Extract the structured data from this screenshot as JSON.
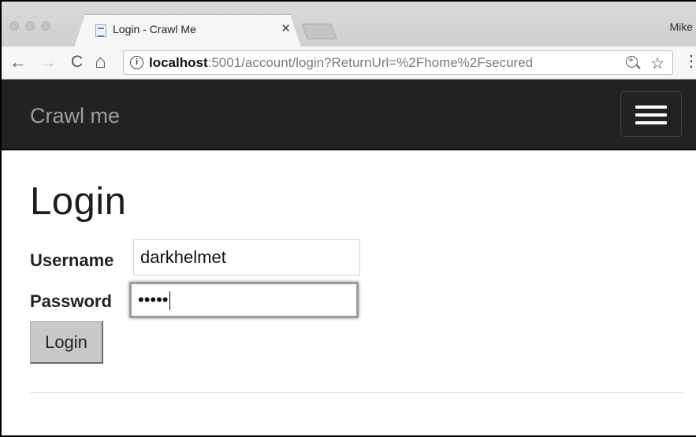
{
  "browser": {
    "tab_title": "Login - Crawl Me",
    "tab_close": "×",
    "profile_name": "Mike",
    "url_host": "localhost",
    "url_rest": ":5001/account/login?ReturnUrl=%2Fhome%2Fsecured",
    "icons": {
      "back": "←",
      "forward": "→",
      "reload": "C",
      "home": "⌂",
      "info": "i",
      "star": "☆",
      "menu": "⋮"
    }
  },
  "navbar": {
    "brand": "Crawl me",
    "toggle_icon": "hamburger-icon"
  },
  "page": {
    "title": "Login",
    "username_label": "Username",
    "username_value": "darkhelmet",
    "password_label": "Password",
    "password_masked": "•••••",
    "submit_label": "Login"
  },
  "colors": {
    "navbar_bg": "#222222",
    "brand_text": "#9d9d9d",
    "button_bg": "#c8c8c8"
  }
}
